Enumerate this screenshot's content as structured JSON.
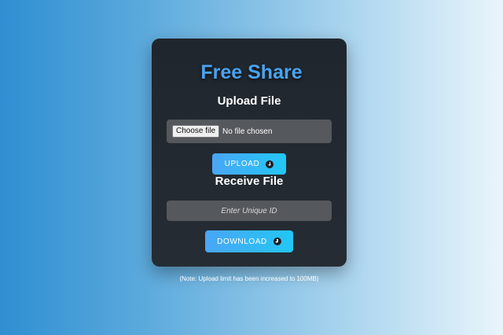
{
  "app": {
    "title": "Free Share"
  },
  "upload": {
    "heading": "Upload File",
    "choose_button_label": "Choose file",
    "file_status": "No file chosen",
    "button_label": "UPLOAD",
    "button_icon": "download-circle-icon"
  },
  "receive": {
    "heading": "Receive File",
    "id_placeholder": "Enter Unique ID",
    "id_value": "",
    "button_label": "DOWNLOAD",
    "button_icon": "download-circle-icon"
  },
  "footer": {
    "note": "(Note: Upload limit has been increased to 100MB)"
  },
  "colors": {
    "title": "#4aa3f0",
    "card_background": "#20262d",
    "button_gradient_start": "#4aa6f6",
    "button_gradient_end": "#22c7f4",
    "input_background": "#55585c"
  }
}
